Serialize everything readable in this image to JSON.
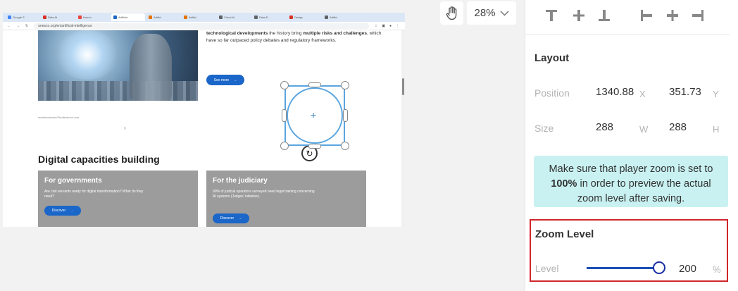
{
  "canvas": {
    "browser": {
      "tabs": [
        "Google S",
        "Data At",
        "How to",
        "Artificia",
        "Artifici",
        "Artifici",
        "Cloud Al",
        "Data-D",
        "Design",
        "Artifici"
      ],
      "address": "unesco.org/en/artificial-intelligence",
      "page": {
        "hero_text_bold_1": "technological developments",
        "hero_text_mid": " the history bring ",
        "hero_text_bold_2": "multiple risks and challenges",
        "hero_text_end": ", which have so far outpaced policy debates and regulatory frameworks.",
        "see_more_label": "See more",
        "image_credit": "metamorworks/Shutterstock.com",
        "carousel_next": "›",
        "section_title": "Digital capacities building",
        "cards": [
          {
            "title": "For governments",
            "description": "Are civil servants ready for digital transformation? What do they need?",
            "button": "Discover"
          },
          {
            "title": "For the judiciary",
            "description": "90% of judicial operators surveyed need legal training concerning AI systems (Judges' initiative).",
            "button": "Discover"
          }
        ]
      }
    },
    "zoom_select_value": "28%",
    "hand_tool_icon": "hand-icon"
  },
  "panel": {
    "layout_title": "Layout",
    "position": {
      "label": "Position",
      "x_value": "1340.88",
      "x_unit": "X",
      "y_value": "351.73",
      "y_unit": "Y"
    },
    "size": {
      "label": "Size",
      "w_value": "288",
      "w_unit": "W",
      "h_value": "288",
      "h_unit": "H"
    },
    "notice_line1": "Make sure that player zoom is set to",
    "notice_bold": "100%",
    "notice_line2": " in order to preview the actual",
    "notice_line3": "zoom level after saving.",
    "zoom_level": {
      "title": "Zoom Level",
      "level_label": "Level",
      "value": "200",
      "unit": "%",
      "slider_fraction": 1.0
    }
  },
  "colors": {
    "accent_blue": "#1a66c9",
    "notice_bg": "#c9f1f1",
    "highlight_red": "#d0262b",
    "selection_blue": "#5aa6e0"
  }
}
